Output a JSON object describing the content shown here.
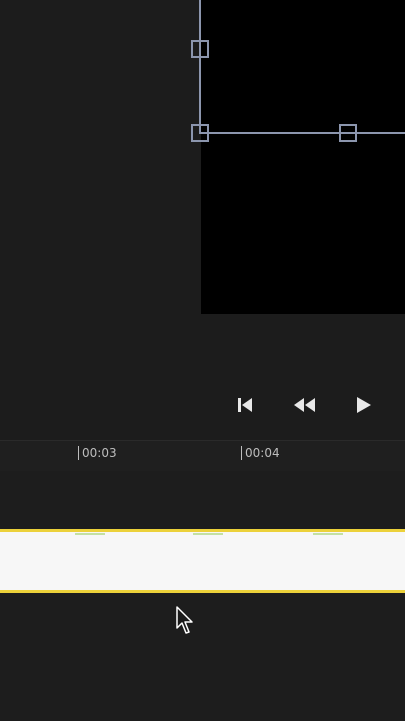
{
  "preview": {
    "canvas_color": "#000000",
    "selection_color": "#8c96ae"
  },
  "playback": {
    "buttons": [
      "skip-to-start",
      "rewind",
      "play"
    ]
  },
  "timeline": {
    "ruler_labels": [
      "00:03",
      "00:04"
    ],
    "clip": {
      "fill_color": "#f7f7f7",
      "border_color": "#ecd13a"
    }
  }
}
